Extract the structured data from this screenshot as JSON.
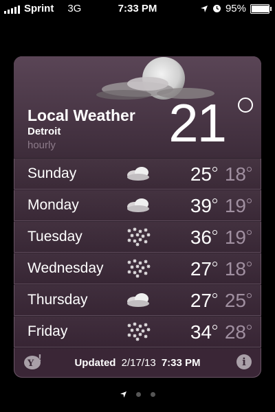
{
  "status_bar": {
    "carrier": "Sprint",
    "network": "3G",
    "time": "7:33 PM",
    "battery": "95%",
    "battery_level": 0.95
  },
  "header": {
    "title": "Local Weather",
    "city": "Detroit",
    "subtitle": "hourly",
    "current_temp": "21",
    "current_conditions_icon": "moon-with-clouds"
  },
  "forecast": [
    {
      "day": "Sunday",
      "icon": "cloudy-icon",
      "high": "25",
      "low": "18"
    },
    {
      "day": "Monday",
      "icon": "cloudy-icon",
      "high": "39",
      "low": "19"
    },
    {
      "day": "Tuesday",
      "icon": "snow-icon",
      "high": "36",
      "low": "19"
    },
    {
      "day": "Wednesday",
      "icon": "snow-icon",
      "high": "27",
      "low": "18"
    },
    {
      "day": "Thursday",
      "icon": "cloudy-icon",
      "high": "27",
      "low": "25"
    },
    {
      "day": "Friday",
      "icon": "snow-icon",
      "high": "34",
      "low": "28"
    }
  ],
  "footer": {
    "updated_label": "Updated",
    "updated_date": "2/17/13",
    "updated_time": "7:33 PM"
  },
  "pager": {
    "pages": 3,
    "current": 1
  },
  "colors": {
    "card_bg": "#3f2d3b",
    "low_temp": "#a08fa0",
    "sub_text": "#8d7b8a"
  }
}
